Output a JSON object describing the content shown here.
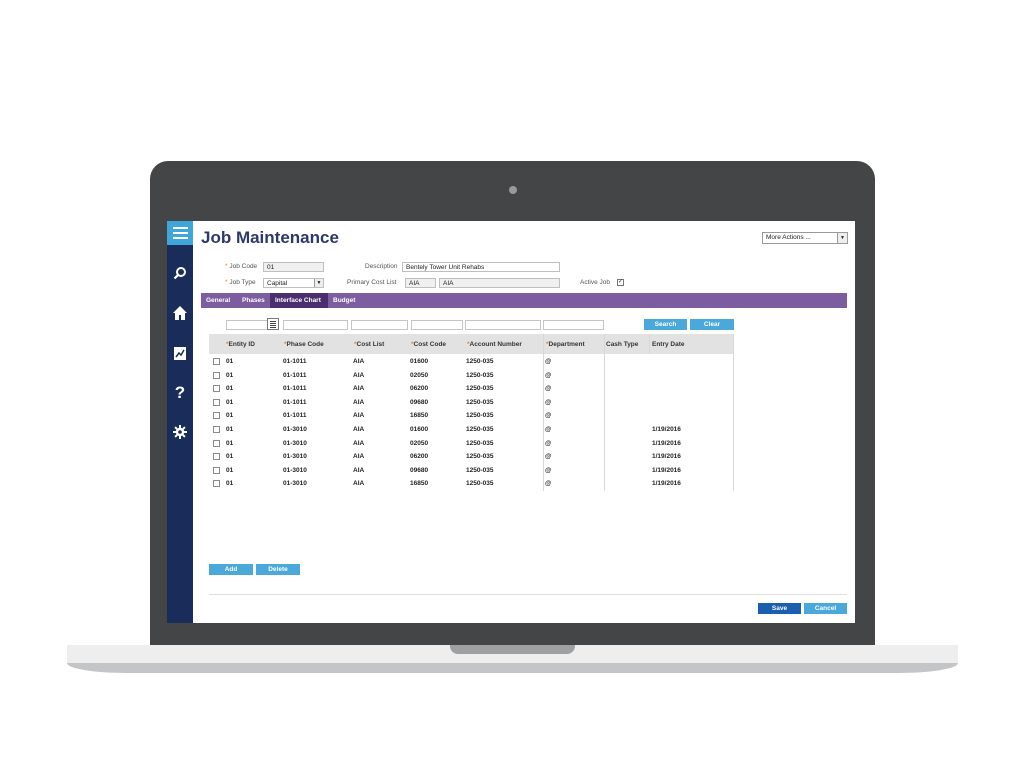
{
  "page": {
    "title": "Job Maintenance"
  },
  "more_actions": {
    "label": "More Actions ..."
  },
  "form": {
    "job_code_label": "Job Code",
    "job_code_value": "01",
    "description_label": "Description",
    "description_value": "Bentely Tower Unit Rehabs",
    "job_type_label": "Job Type",
    "job_type_value": "Capital",
    "primary_cost_list_label": "Primary Cost List",
    "primary_cost_list_code": "AIA",
    "primary_cost_list_name": "AIA",
    "active_job_label": "Active Job",
    "active_job_checked": "✓"
  },
  "tabs": [
    "General",
    "Phases",
    "Interface Chart",
    "Budget"
  ],
  "active_tab": "Interface Chart",
  "toolbar": {
    "search_label": "Search",
    "clear_label": "Clear"
  },
  "table": {
    "columns": [
      "Entity ID",
      "Phase Code",
      "Cost List",
      "Cost Code",
      "Account Number",
      "Department",
      "Cash Type",
      "Entry Date"
    ],
    "required_columns": [
      true,
      true,
      true,
      true,
      true,
      true,
      false,
      false
    ],
    "rows": [
      [
        "01",
        "01-1011",
        "AIA",
        "01600",
        "1250-035",
        "@",
        "",
        ""
      ],
      [
        "01",
        "01-1011",
        "AIA",
        "02050",
        "1250-035",
        "@",
        "",
        ""
      ],
      [
        "01",
        "01-1011",
        "AIA",
        "06200",
        "1250-035",
        "@",
        "",
        ""
      ],
      [
        "01",
        "01-1011",
        "AIA",
        "09680",
        "1250-035",
        "@",
        "",
        ""
      ],
      [
        "01",
        "01-1011",
        "AIA",
        "16850",
        "1250-035",
        "@",
        "",
        ""
      ],
      [
        "01",
        "01-3010",
        "AIA",
        "01600",
        "1250-035",
        "@",
        "",
        "1/19/2016"
      ],
      [
        "01",
        "01-3010",
        "AIA",
        "02050",
        "1250-035",
        "@",
        "",
        "1/19/2016"
      ],
      [
        "01",
        "01-3010",
        "AIA",
        "06200",
        "1250-035",
        "@",
        "",
        "1/19/2016"
      ],
      [
        "01",
        "01-3010",
        "AIA",
        "09680",
        "1250-035",
        "@",
        "",
        "1/19/2016"
      ],
      [
        "01",
        "01-3010",
        "AIA",
        "16850",
        "1250-035",
        "@",
        "",
        "1/19/2016"
      ]
    ]
  },
  "grid_actions": {
    "add_label": "Add",
    "delete_label": "Delete"
  },
  "footer": {
    "save_label": "Save",
    "cancel_label": "Cancel"
  },
  "sidebar": {
    "icons": [
      "search-icon",
      "home-icon",
      "report-icon",
      "help-icon",
      "gear-icon"
    ]
  },
  "colors": {
    "sidebar": "#1a2d5a",
    "accent": "#4aa8db",
    "tabbar": "#7b5da0",
    "active_tab": "#4a2e6d",
    "title": "#2b3a6b"
  }
}
